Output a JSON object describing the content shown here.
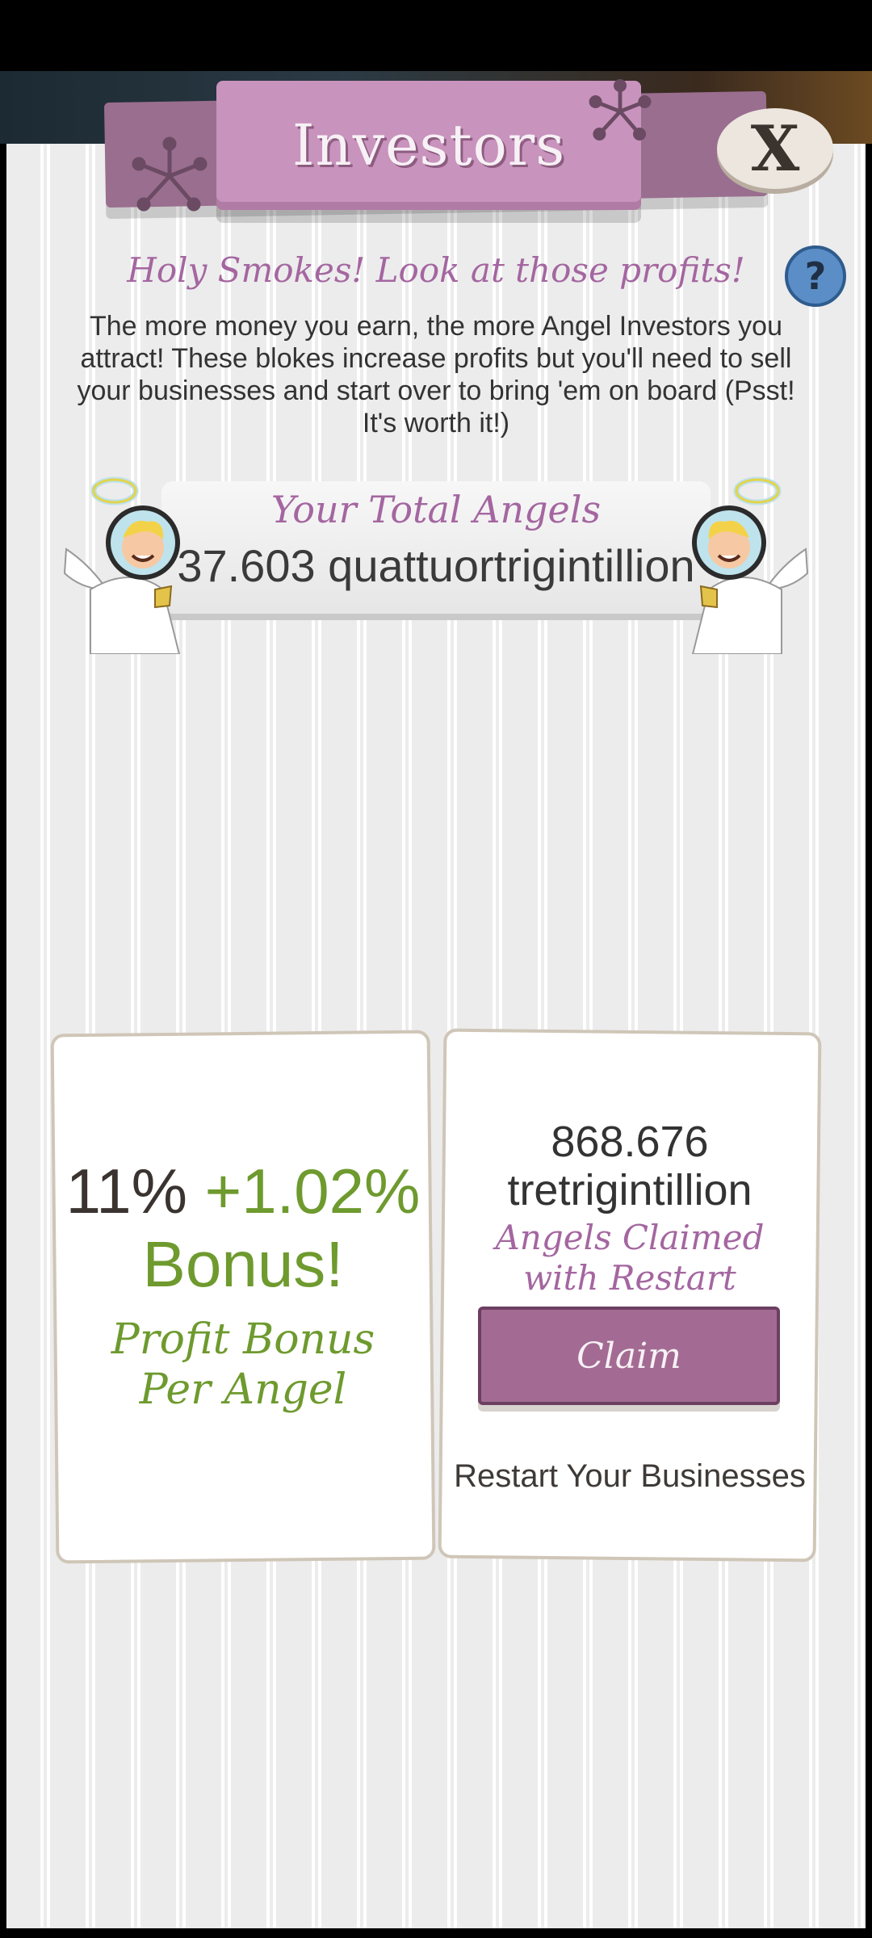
{
  "header": {
    "title": "Investors",
    "close_label": "X"
  },
  "help": {
    "label": "?"
  },
  "intro": {
    "headline": "Holy Smokes! Look at those profits!",
    "body": "The more money you earn, the more Angel Investors you attract! These blokes increase profits but you'll need to sell your businesses and start over to bring 'em on board (Psst! It's worth it!)"
  },
  "total_angels": {
    "label": "Your Total Angels",
    "value": "37.603 quattuortrigintillion"
  },
  "bonus_card": {
    "base": "11%",
    "plus": "+1.02%",
    "word": "Bonus!",
    "caption_line1": "Profit Bonus",
    "caption_line2": "Per Angel"
  },
  "claim_card": {
    "amount_line1": "868.676",
    "amount_line2": "tretrigintillion",
    "caption_line1": "Angels Claimed",
    "caption_line2": "with Restart",
    "button_label": "Claim",
    "restart_label": "Restart Your Businesses"
  },
  "colors": {
    "accent": "#a466a0",
    "bonus_green": "#6e9a2e",
    "banner": "#c893bd",
    "help": "#5b8ec7"
  }
}
